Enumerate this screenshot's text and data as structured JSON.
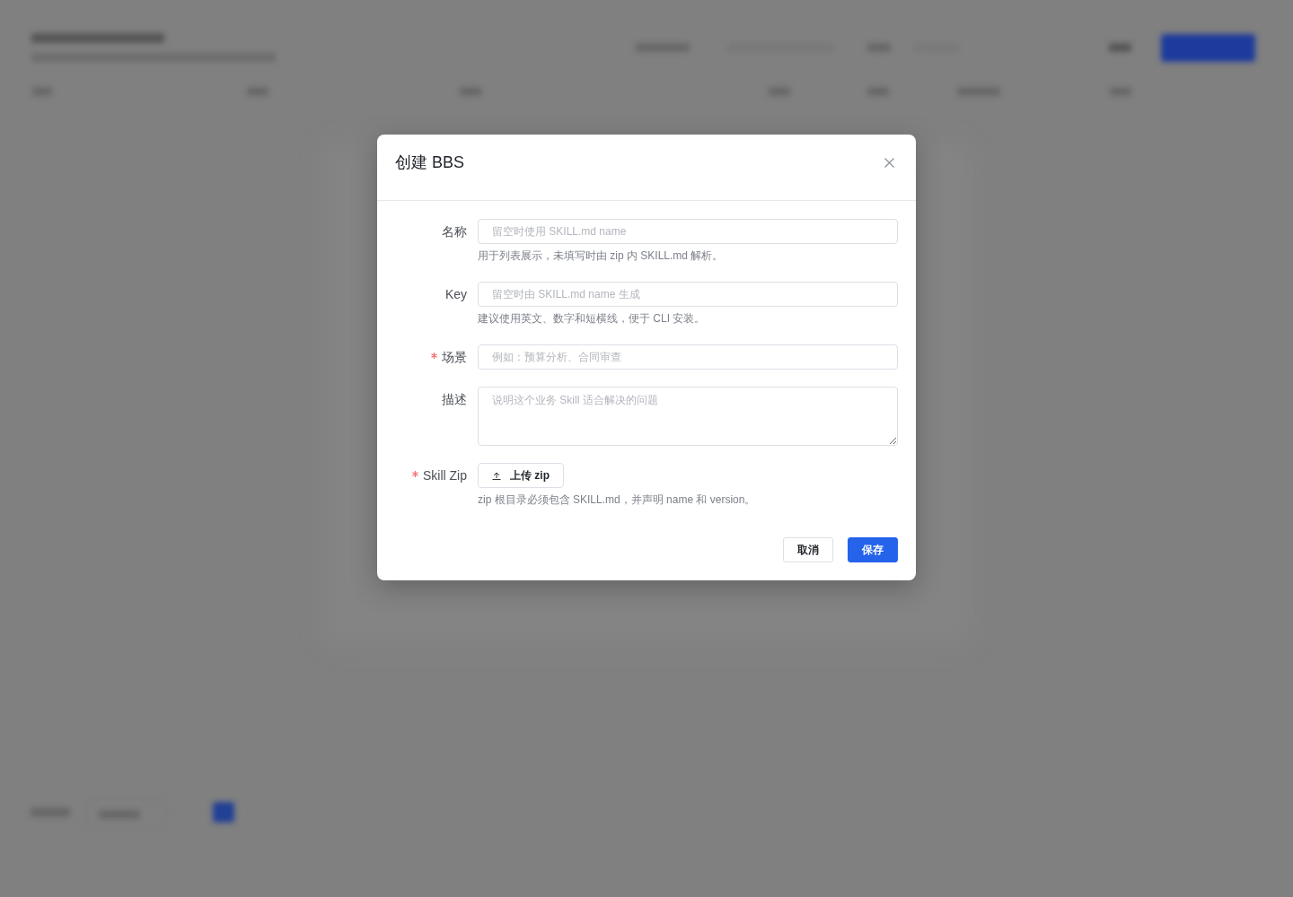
{
  "dialog": {
    "title": "创建 BBS",
    "fields": [
      {
        "kind": "input",
        "label": "名称",
        "required": false,
        "placeholder": "留空时使用 SKILL.md name",
        "help": "用于列表展示，未填写时由 zip 内 SKILL.md 解析。"
      },
      {
        "kind": "input",
        "label": "Key",
        "required": false,
        "placeholder": "留空时由 SKILL.md name 生成",
        "help": "建议使用英文、数字和短横线，便于 CLI 安装。"
      },
      {
        "kind": "input",
        "label": "场景",
        "required": true,
        "placeholder": "例如：预算分析、合同审查"
      },
      {
        "kind": "textarea",
        "label": "描述",
        "required": false,
        "placeholder": "说明这个业务 Skill 适合解决的问题"
      },
      {
        "kind": "upload",
        "label": "Skill Zip",
        "required": true,
        "button": "上传 zip",
        "help": "zip 根目录必须包含 SKILL.md，并声明 name 和 version。"
      }
    ],
    "buttons": [
      {
        "kind": "secondary",
        "label": "取消"
      },
      {
        "kind": "primary",
        "label": "保存"
      }
    ]
  }
}
